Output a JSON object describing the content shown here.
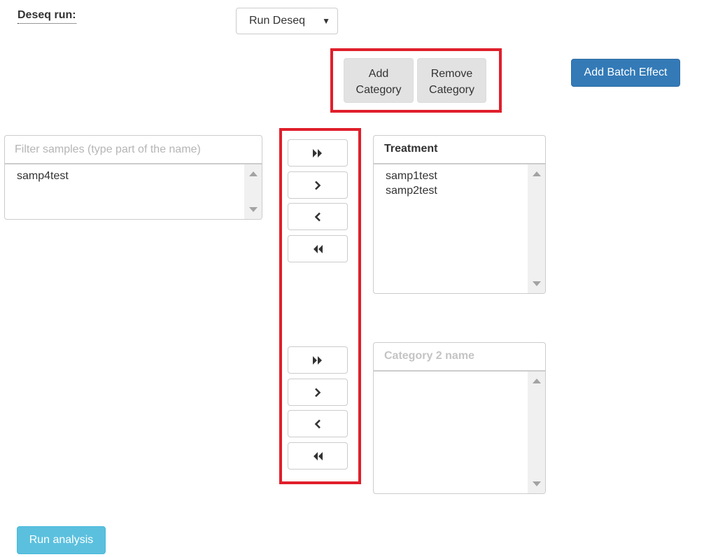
{
  "deseq": {
    "label": "Deseq run:",
    "select_value": "Run Deseq",
    "caret": "▼"
  },
  "category_buttons": {
    "add_line1": "Add",
    "add_line2": "Category",
    "remove_line1": "Remove",
    "remove_line2": "Category"
  },
  "batch_button": "Add Batch Effect",
  "filter": {
    "placeholder": "Filter samples (type part of the name)"
  },
  "available_samples": [
    "samp4test"
  ],
  "categories": [
    {
      "name": "Treatment",
      "samples": [
        "samp1test",
        "samp2test"
      ]
    },
    {
      "name": "",
      "placeholder": "Category 2 name",
      "samples": []
    }
  ],
  "arrow_icons": [
    "move-all-right-icon",
    "move-right-icon",
    "move-left-icon",
    "move-all-left-icon"
  ],
  "run_button": "Run analysis",
  "colors": {
    "highlight": "#e01f2b",
    "primary": "#337ab7",
    "info": "#5bc0de"
  }
}
